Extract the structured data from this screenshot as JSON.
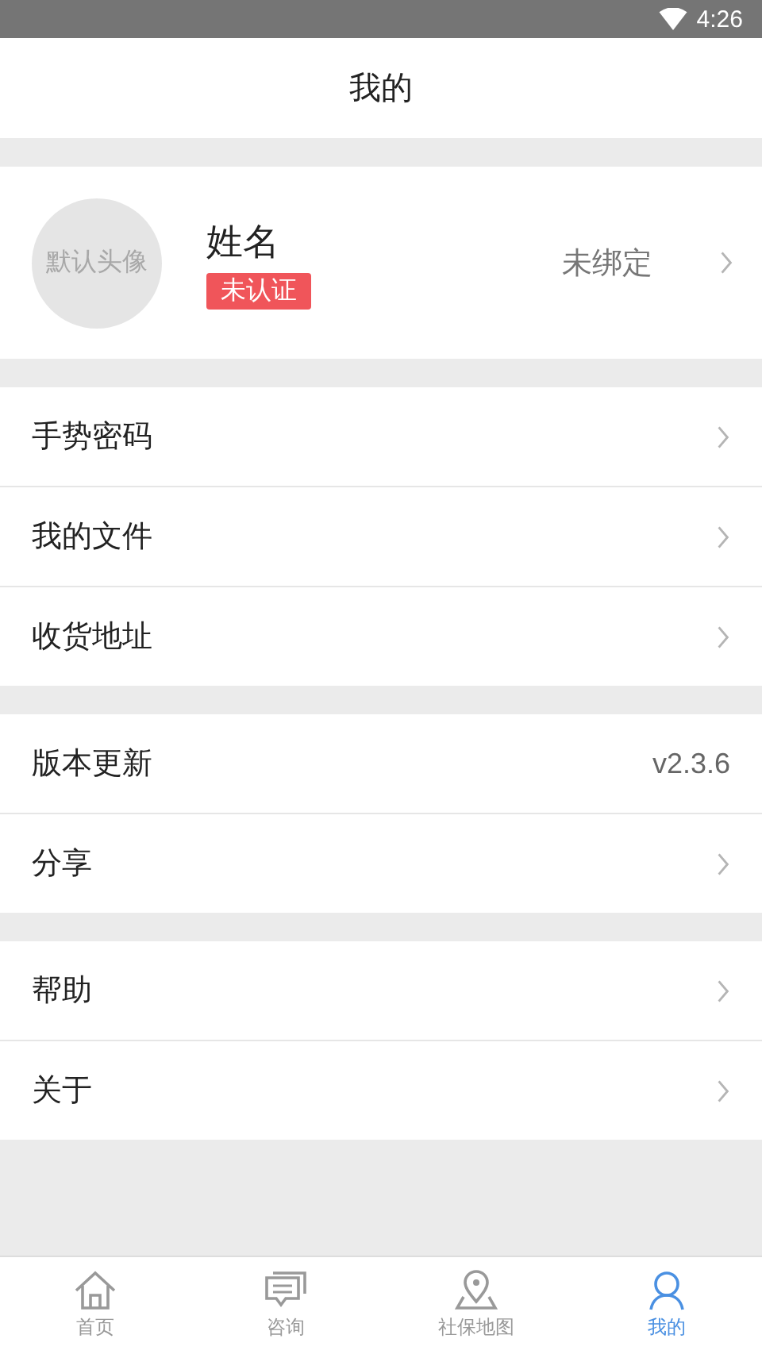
{
  "status_bar": {
    "time": "4:26"
  },
  "header": {
    "title": "我的"
  },
  "profile": {
    "avatar_text": "默认头像",
    "name": "姓名",
    "badge": "未认证",
    "binding": "未绑定"
  },
  "menu_groups": [
    {
      "items": [
        {
          "label": "手势密码",
          "kind": "link"
        },
        {
          "label": "我的文件",
          "kind": "link"
        },
        {
          "label": "收货地址",
          "kind": "link"
        }
      ]
    },
    {
      "items": [
        {
          "label": "版本更新",
          "kind": "value",
          "value": "v2.3.6"
        },
        {
          "label": "分享",
          "kind": "link"
        }
      ]
    },
    {
      "items": [
        {
          "label": "帮助",
          "kind": "link"
        },
        {
          "label": "关于",
          "kind": "link"
        }
      ]
    }
  ],
  "tab_bar": [
    {
      "label": "首页",
      "kind": "home",
      "selected": false
    },
    {
      "label": "咨询",
      "kind": "chat",
      "selected": false
    },
    {
      "label": "社保地图",
      "kind": "map",
      "selected": false
    },
    {
      "label": "我的",
      "kind": "person",
      "selected": true
    }
  ]
}
